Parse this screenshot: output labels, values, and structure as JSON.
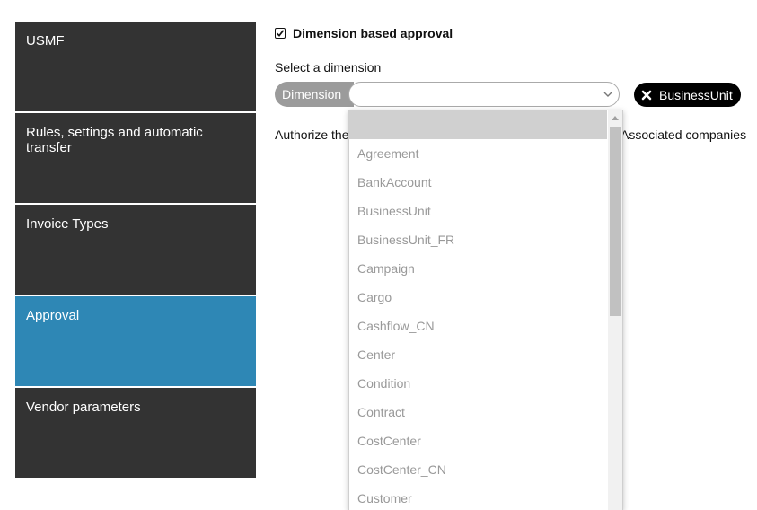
{
  "nav": {
    "items": [
      {
        "label": "USMF",
        "active": false
      },
      {
        "label": "Rules, settings and automatic transfer",
        "active": false
      },
      {
        "label": "Invoice Types",
        "active": false
      },
      {
        "label": "Approval",
        "active": true
      },
      {
        "label": "Vendor parameters",
        "active": false
      }
    ]
  },
  "approval": {
    "dimension_based_label": "Dimension based approval",
    "dimension_based_checked": true,
    "select_label": "Select a dimension",
    "dimension_pill": "Dimension",
    "dimension_value": "",
    "selected_tag": "BusinessUnit",
    "authorize_left": "Authorize the",
    "authorize_right": "Associated companies"
  },
  "dropdown": {
    "options": [
      "Agreement",
      "BankAccount",
      "BusinessUnit",
      "BusinessUnit_FR",
      "Campaign",
      "Cargo",
      "Cashflow_CN",
      "Center",
      "Condition",
      "Contract",
      "CostCenter",
      "CostCenter_CN",
      "Customer"
    ]
  },
  "colors": {
    "nav_bg": "#333333",
    "nav_active": "#2e87b5",
    "pill_bg": "#9b9b9b",
    "tag_bg": "#000000",
    "option_text": "#999999"
  }
}
